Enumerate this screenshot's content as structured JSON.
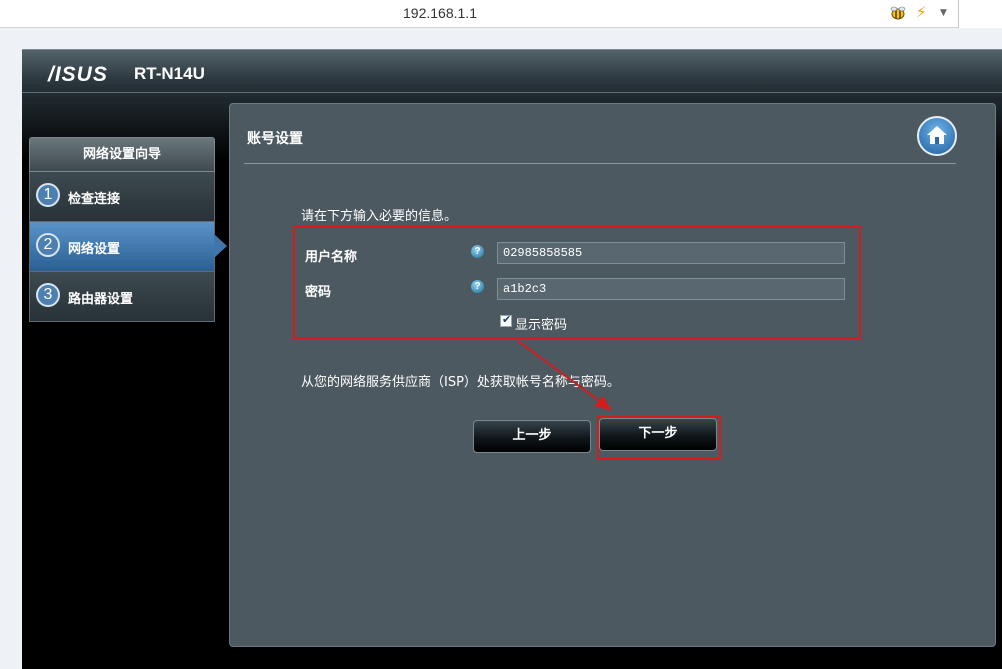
{
  "browser": {
    "url": "192.168.1.1",
    "icons": [
      "bee-icon",
      "lightning-icon",
      "dropdown-arrow-icon"
    ]
  },
  "router": {
    "brand": "/ISUS",
    "model": "RT-N14U"
  },
  "sidebar": {
    "title": "网络设置向导",
    "steps": [
      {
        "number": "1",
        "label": "检查连接",
        "active": false
      },
      {
        "number": "2",
        "label": "网络设置",
        "active": true
      },
      {
        "number": "3",
        "label": "路由器设置",
        "active": false
      }
    ]
  },
  "panel": {
    "title": "账号设置",
    "home_icon": "home-icon",
    "instruction": "请在下方输入必要的信息。",
    "username_label": "用户名称",
    "username_value": "02985858585",
    "password_label": "密码",
    "password_value": "a1b2c3",
    "show_password_label": "显示密码",
    "show_password_checked": true,
    "isp_note": "从您的网络服务供应商（ISP）处获取帐号名称与密码。",
    "prev_button": "上一步",
    "next_button": "下一步"
  },
  "colors": {
    "panel_bg": "#4d5960",
    "annotation_red": "#d41c1c",
    "active_step": "#3f76ab"
  }
}
